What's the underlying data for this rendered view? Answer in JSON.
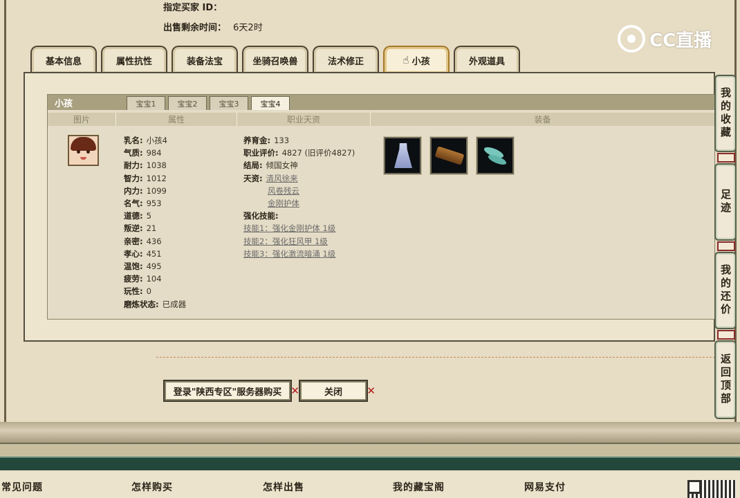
{
  "top_info": {
    "buyer_label": "指定买家 ID：",
    "buyer_value": "",
    "time_label": "出售剩余时间：",
    "time_value": "6天2时"
  },
  "logo": {
    "text": "CC直播"
  },
  "tabs": [
    {
      "label": "基本信息"
    },
    {
      "label": "属性抗性"
    },
    {
      "label": "装备法宝"
    },
    {
      "label": "坐骑召唤兽"
    },
    {
      "label": "法术修正"
    },
    {
      "label": "小孩",
      "active": true
    },
    {
      "label": "外观道具"
    }
  ],
  "panel": {
    "title": "小孩",
    "sub_tabs": [
      "宝宝1",
      "宝宝2",
      "宝宝3",
      "宝宝4"
    ],
    "active_sub_tab": "宝宝4",
    "columns": [
      "图片",
      "属性",
      "职业天资",
      "装备"
    ]
  },
  "attributes": [
    {
      "k": "乳名:",
      "v": "小孩4"
    },
    {
      "k": "气质:",
      "v": "984"
    },
    {
      "k": "耐力:",
      "v": "1038"
    },
    {
      "k": "智力:",
      "v": "1012"
    },
    {
      "k": "内力:",
      "v": "1099"
    },
    {
      "k": "名气:",
      "v": "953"
    },
    {
      "k": "道德:",
      "v": "5"
    },
    {
      "k": "叛逆:",
      "v": "21"
    },
    {
      "k": "亲密:",
      "v": "436"
    },
    {
      "k": "孝心:",
      "v": "451"
    },
    {
      "k": "温饱:",
      "v": "495"
    },
    {
      "k": "疲劳:",
      "v": "104"
    },
    {
      "k": "玩性:",
      "v": "0"
    },
    {
      "k": "磨炼状态:",
      "v": "已成器"
    }
  ],
  "career": {
    "yangyujin_k": "养育金:",
    "yangyujin_v": "133",
    "pingjia_k": "职业评价:",
    "pingjia_v": "4827 (旧评价4827)",
    "jieju_k": "结局:",
    "jieju_v": "倾国女神",
    "tianzi_k": "天资:",
    "tianzi": [
      "清风徐来",
      "风卷残云",
      "金刚护体"
    ],
    "skills_k": "强化技能:",
    "skills": [
      "技能1：强化金刚护体 1级",
      "技能2：强化狂风甲 1级",
      "技能3：强化激流暗涌 1级"
    ]
  },
  "equipment_icons": [
    "dress-icon",
    "guqin-icon",
    "shoes-icon"
  ],
  "buttons": {
    "buy": "登录\"陕西专区\"服务器购买",
    "close": "关闭"
  },
  "side_nav": [
    {
      "label": "我的收藏"
    },
    {
      "label": "足迹"
    },
    {
      "label": "我的还价"
    },
    {
      "label": "返回顶部"
    }
  ],
  "footer": [
    "常见问题",
    "怎样购买",
    "怎样出售",
    "我的藏宝阁",
    "网易支付"
  ],
  "colors": {
    "background": "#e7dcc4",
    "active_tab_border": "#a37a2c",
    "header_bar": "#a9a080",
    "close_mark": "#b31b1b",
    "footer_band": "#24473b"
  }
}
